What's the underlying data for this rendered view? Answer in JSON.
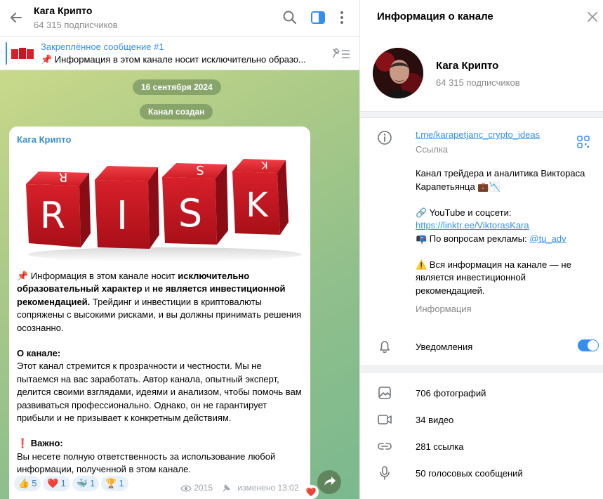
{
  "chat": {
    "title": "Кага Крипто",
    "subscribers": "64 315 подписчиков",
    "pinned": {
      "title": "Закреплённое сообщение #1",
      "text": "📌 Информация в этом канале носит исключительно образо..."
    },
    "date_chip": "16 сентября 2024",
    "created_chip": "Канал создан",
    "message": {
      "author": "Кага Крипто",
      "image_text": "RISK",
      "p1_a": "📌 Информация в этом канале носит ",
      "p1_b": "исключительно образовательный характер",
      "p1_c": " и ",
      "p1_d": "не является инвестиционной рекомендацией.",
      "p1_e": " Трейдинг и инвестиции в криптовалюты сопряжены с высокими рисками, и вы должны принимать решения осознанно.",
      "about_heading": "О канале:",
      "about_text": "Этот канал стремится к прозрачности и честности. Мы не пытаемся на вас заработать. Автор канала, опытный эксперт, делится своими взглядами, идеями и анализом, чтобы помочь вам развиваться профессионально. Однако, он не гарантирует прибыли и не призывает к конкретным действиям.",
      "important_heading": "❗ Важно:",
      "important_text": "Вы несете полную ответственность за использование любой информации, полученной в этом канале.",
      "reactions": [
        {
          "emoji": "👍",
          "count": "5"
        },
        {
          "emoji": "❤️",
          "count": "1"
        },
        {
          "emoji": "🐳",
          "count": "1"
        },
        {
          "emoji": "🏆",
          "count": "1"
        }
      ],
      "views": "2015",
      "edited": "изменено 13:02",
      "heart_badge": "❤️"
    }
  },
  "info": {
    "title": "Информация о канале",
    "name": "Кага Крипто",
    "subscribers": "64 315 подписчиков",
    "link": "t.me/karapetjanc_crypto_ideas",
    "link_label": "Ссылка",
    "desc_line1": "Канал трейдера и аналитика Виктораса Карапетьянца 💼📉",
    "desc_line2": "🔗 YouTube и соцсети:",
    "desc_url": "https://linktr.ee/ViktorasKara",
    "desc_ads_prefix": "📭 По вопросам рекламы: ",
    "desc_ads_handle": "@tu_adv",
    "desc_warning": "⚠️ Вся информация на канале — не является инвестиционной рекомендацией.",
    "desc_label": "Информация",
    "notifications": "Уведомления",
    "notifications_on": true,
    "media": {
      "photos": "706 фотографий",
      "videos": "34 видео",
      "links": "281 ссылка",
      "voice": "50 голосовых сообщений"
    }
  },
  "colors": {
    "accent": "#3390ec",
    "author": "#3a8fc8",
    "muted": "#8a8a8a",
    "risk_red": "#d8202a"
  }
}
